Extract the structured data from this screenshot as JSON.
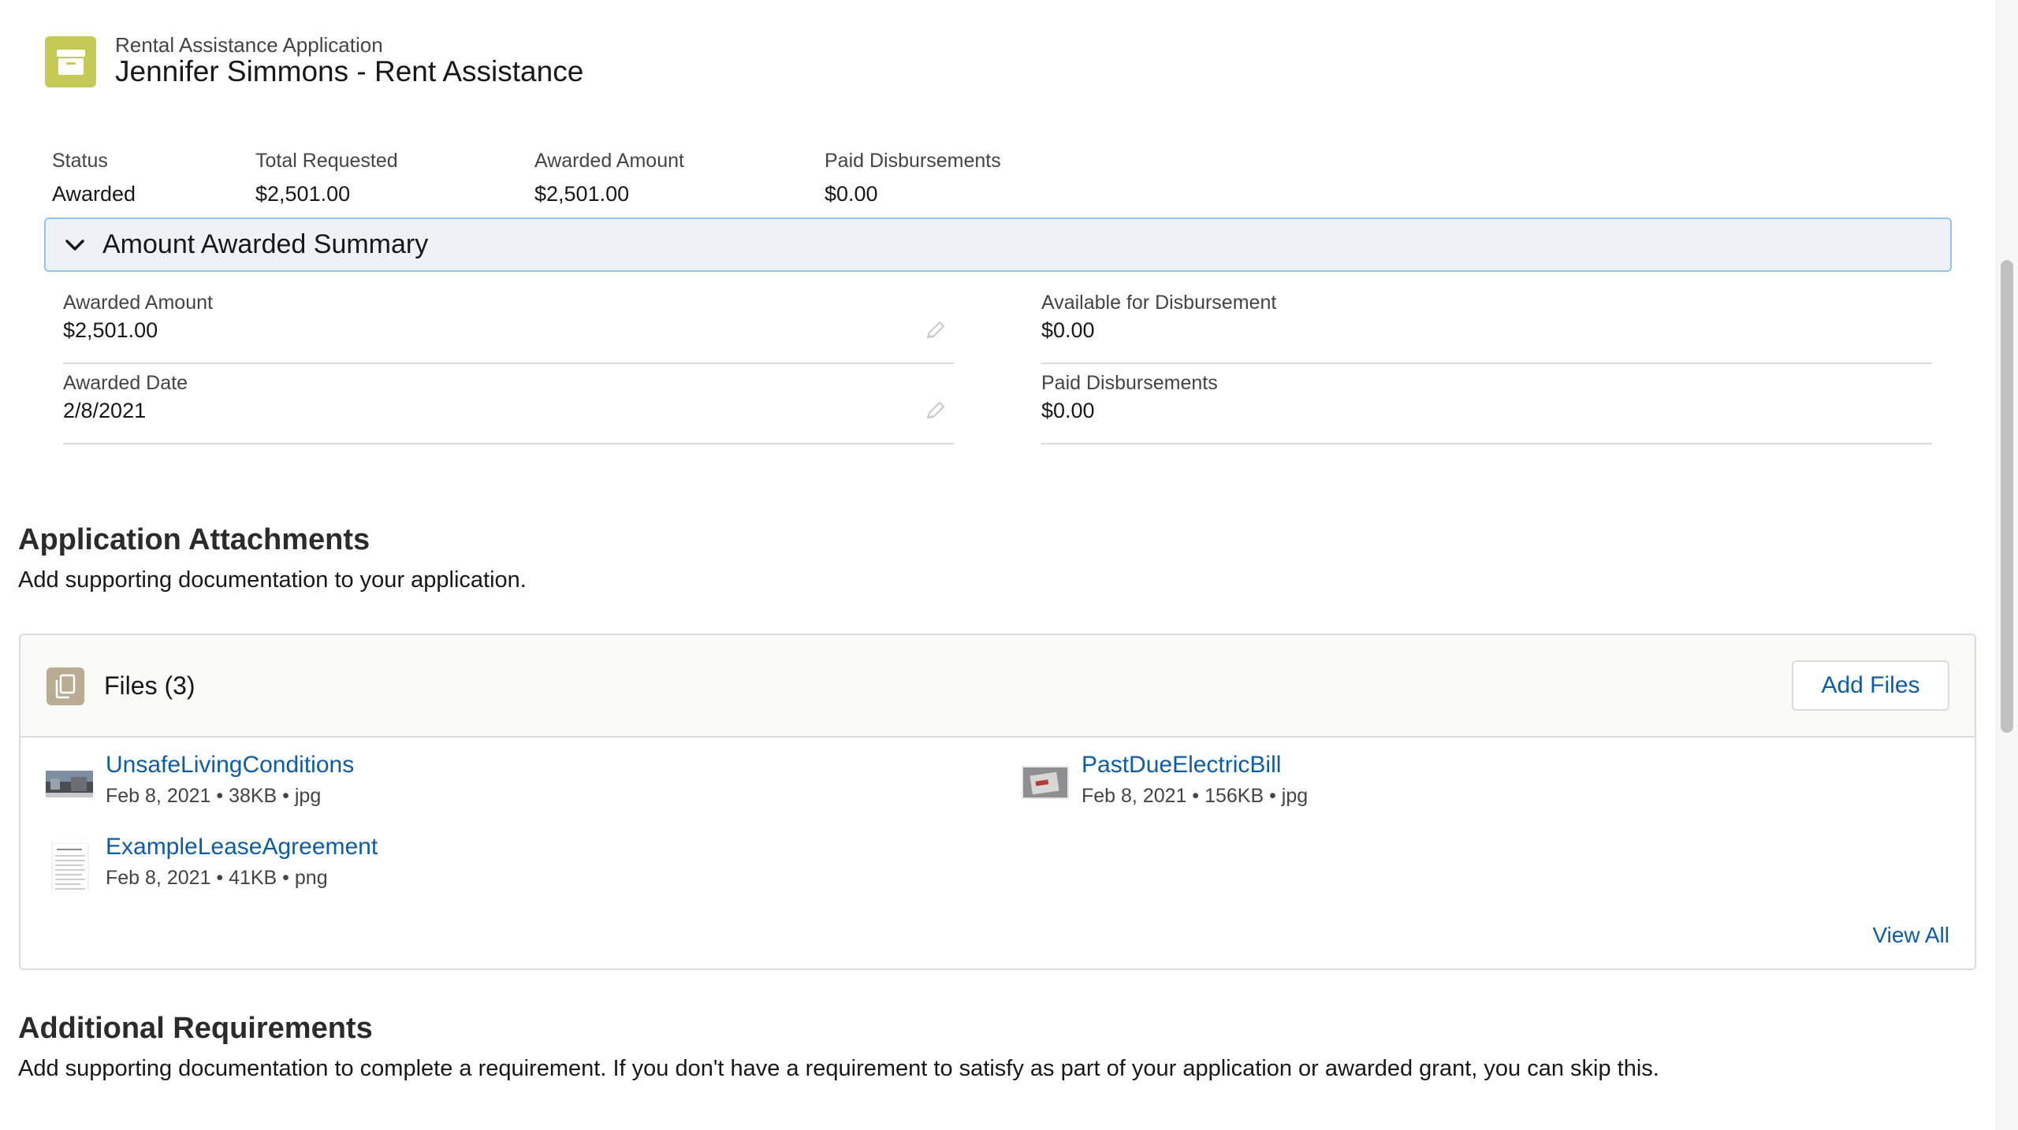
{
  "header": {
    "icon": "archive-icon",
    "eyebrow": "Rental Assistance Application",
    "title": "Jennifer Simmons - Rent Assistance",
    "icon_color": "#c5c955"
  },
  "highlights": [
    {
      "label": "Status",
      "value": "Awarded"
    },
    {
      "label": "Total Requested",
      "value": "$2,501.00"
    },
    {
      "label": "Awarded Amount",
      "value": "$2,501.00"
    },
    {
      "label": "Paid Disbursements",
      "value": "$0.00"
    }
  ],
  "summary_section": {
    "title": "Amount Awarded Summary",
    "expanded": true,
    "fields": [
      {
        "label": "Awarded Amount",
        "value": "$2,501.00",
        "editable": true
      },
      {
        "label": "Available for Disbursement",
        "value": "$0.00",
        "editable": false
      },
      {
        "label": "Awarded Date",
        "value": "2/8/2021",
        "editable": true
      },
      {
        "label": "Paid Disbursements",
        "value": "$0.00",
        "editable": false
      }
    ]
  },
  "attachments": {
    "heading": "Application Attachments",
    "description": "Add supporting documentation to your application."
  },
  "files_card": {
    "title": "Files (3)",
    "add_button": "Add Files",
    "view_all": "View All",
    "files": [
      {
        "name": "UnsafeLivingConditions",
        "meta": "Feb 8, 2021 • 38KB • jpg",
        "thumb": "photo-thumbnail"
      },
      {
        "name": "PastDueElectricBill",
        "meta": "Feb 8, 2021 • 156KB • jpg",
        "thumb": "photo-thumbnail"
      },
      {
        "name": "ExampleLeaseAgreement",
        "meta": "Feb 8, 2021 • 41KB • png",
        "thumb": "document-thumbnail"
      }
    ]
  },
  "additional": {
    "heading": "Additional Requirements",
    "description": "Add supporting documentation to complete a requirement. If you don't have a requirement to satisfy as part of your application or awarded grant, you can skip this."
  },
  "colors": {
    "link": "#0b5cab",
    "section_bg": "#eef1f6",
    "section_border": "#90c3f5",
    "files_icon": "#baac93"
  }
}
